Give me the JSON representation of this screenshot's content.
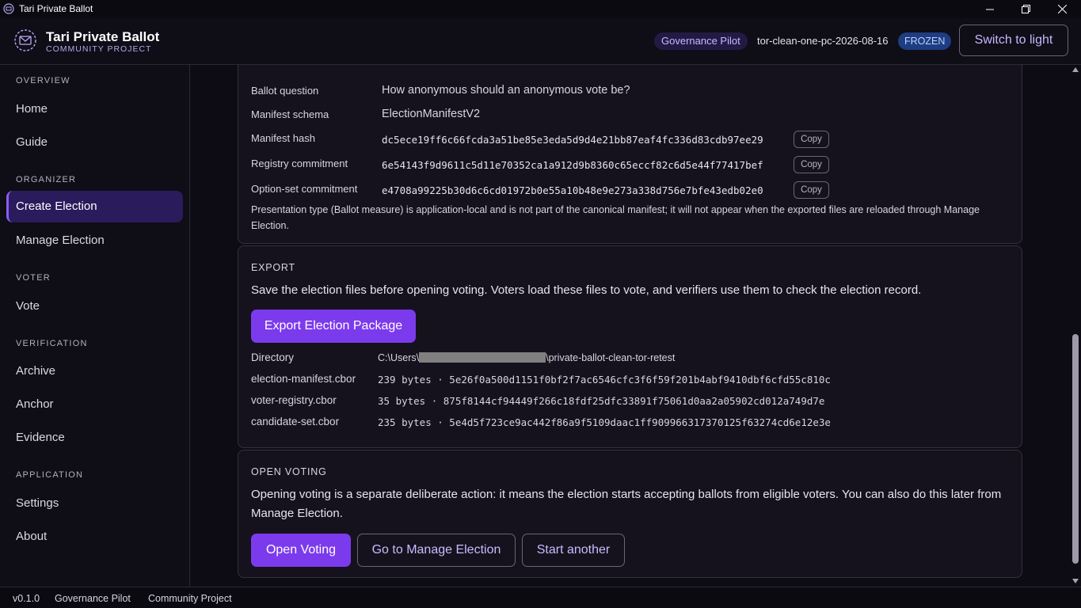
{
  "window": {
    "title": "Tari Private Ballot"
  },
  "header": {
    "brand_title": "Tari Private Ballot",
    "brand_subtitle": "COMMUNITY PROJECT",
    "pilot_pill": "Governance Pilot",
    "election_id": "tor-clean-one-pc-2026-08-16",
    "status_badge": "FROZEN",
    "theme_toggle": "Switch to light"
  },
  "sidebar": {
    "sections": [
      {
        "label": "OVERVIEW",
        "items": [
          "Home",
          "Guide"
        ]
      },
      {
        "label": "ORGANIZER",
        "items": [
          "Create Election",
          "Manage Election"
        ]
      },
      {
        "label": "VOTER",
        "items": [
          "Vote"
        ]
      },
      {
        "label": "VERIFICATION",
        "items": [
          "Archive",
          "Anchor",
          "Evidence"
        ]
      },
      {
        "label": "APPLICATION",
        "items": [
          "Settings",
          "About"
        ]
      }
    ],
    "active": "Create Election"
  },
  "manifest": {
    "ballot_question_label": "Ballot question",
    "ballot_question": "How anonymous should an anonymous vote be?",
    "schema_label": "Manifest schema",
    "schema": "ElectionManifestV2",
    "hash_label": "Manifest hash",
    "hash": "dc5ece19ff6c66fcda3a51be85e3eda5d9d4e21bb87eaf4fc336d83cdb97ee29",
    "registry_label": "Registry commitment",
    "registry": "6e54143f9d9611c5d11e70352ca1a912d9b8360c65eccf82c6d5e44f77417bef",
    "option_label": "Option-set commitment",
    "option": "e4708a99225b30d6c6cd01972b0e55a10b48e9e273a338d756e7bfe43edb02e0",
    "copy_label": "Copy",
    "note": "Presentation type (Ballot measure) is application-local and is not part of the canonical manifest; it will not appear when the exported files are reloaded through Manage Election."
  },
  "export": {
    "title": "EXPORT",
    "description": "Save the election files before opening voting. Voters load these files to vote, and verifiers use them to check the election record.",
    "button": "Export Election Package",
    "directory_label": "Directory",
    "directory_prefix": "C:\\Users\\",
    "directory_suffix": "\\private-ballot-clean-tor-retest",
    "files": [
      {
        "name": "election-manifest.cbor",
        "info": "239 bytes · 5e26f0a500d1151f0bf2f7ac6546cfc3f6f59f201b4abf9410dbf6cfd55c810c"
      },
      {
        "name": "voter-registry.cbor",
        "info": "35 bytes · 875f8144cf94449f266c18fdf25dfc33891f75061d0aa2a05902cd012a749d7e"
      },
      {
        "name": "candidate-set.cbor",
        "info": "235 bytes · 5e4d5f723ce9ac442f86a9f5109daac1ff909966317370125f63274cd6e12e3e"
      }
    ]
  },
  "open_voting": {
    "title": "OPEN VOTING",
    "description": "Opening voting is a separate deliberate action: it means the election starts accepting ballots from eligible voters. You can also do this later from Manage Election.",
    "open_button": "Open Voting",
    "manage_button": "Go to Manage Election",
    "another_button": "Start another"
  },
  "statusbar": {
    "version": "v0.1.0",
    "mode": "Governance Pilot",
    "project": "Community Project"
  },
  "colors": {
    "accent": "#7c3aed",
    "background": "#0d0b14",
    "card": "#15121d"
  }
}
